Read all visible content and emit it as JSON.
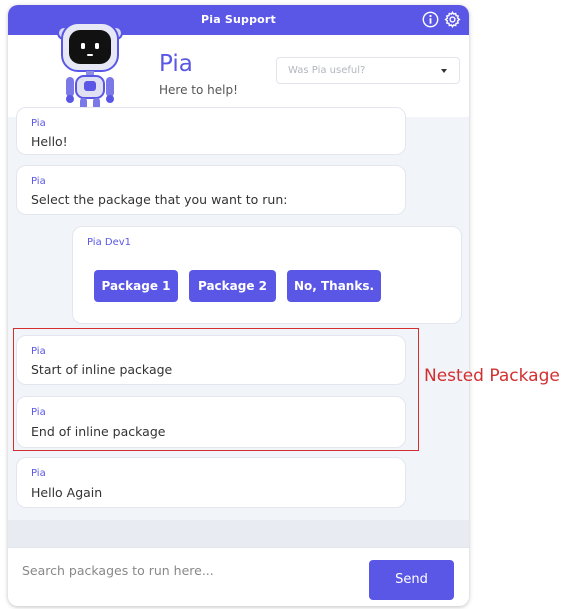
{
  "window": {
    "title": "Pia Support"
  },
  "header": {
    "bot_name": "Pia",
    "tagline": "Here to help!",
    "feedback_placeholder": "Was Pia useful?"
  },
  "messages": [
    {
      "sender": "Pia",
      "text": "Hello!"
    },
    {
      "sender": "Pia",
      "text": "Select the package that you want to run:"
    }
  ],
  "package_card": {
    "sender": "Pia Dev1",
    "buttons": [
      "Package 1",
      "Package 2",
      "No, Thanks."
    ]
  },
  "nested_messages": [
    {
      "sender": "Pia",
      "text": "Start of inline package"
    },
    {
      "sender": "Pia",
      "text": "End of inline package"
    }
  ],
  "final_message": {
    "sender": "Pia",
    "text": "Hello Again"
  },
  "annotation": {
    "label": "Nested Package"
  },
  "composer": {
    "placeholder": "Search packages to run here...",
    "send_label": "Send"
  },
  "colors": {
    "accent": "#5b57e6",
    "annotation": "#d32f2f",
    "chat_bg": "#f1f4f9"
  },
  "icons": [
    "info-icon",
    "gear-icon",
    "chevron-down-icon",
    "robot-avatar"
  ]
}
